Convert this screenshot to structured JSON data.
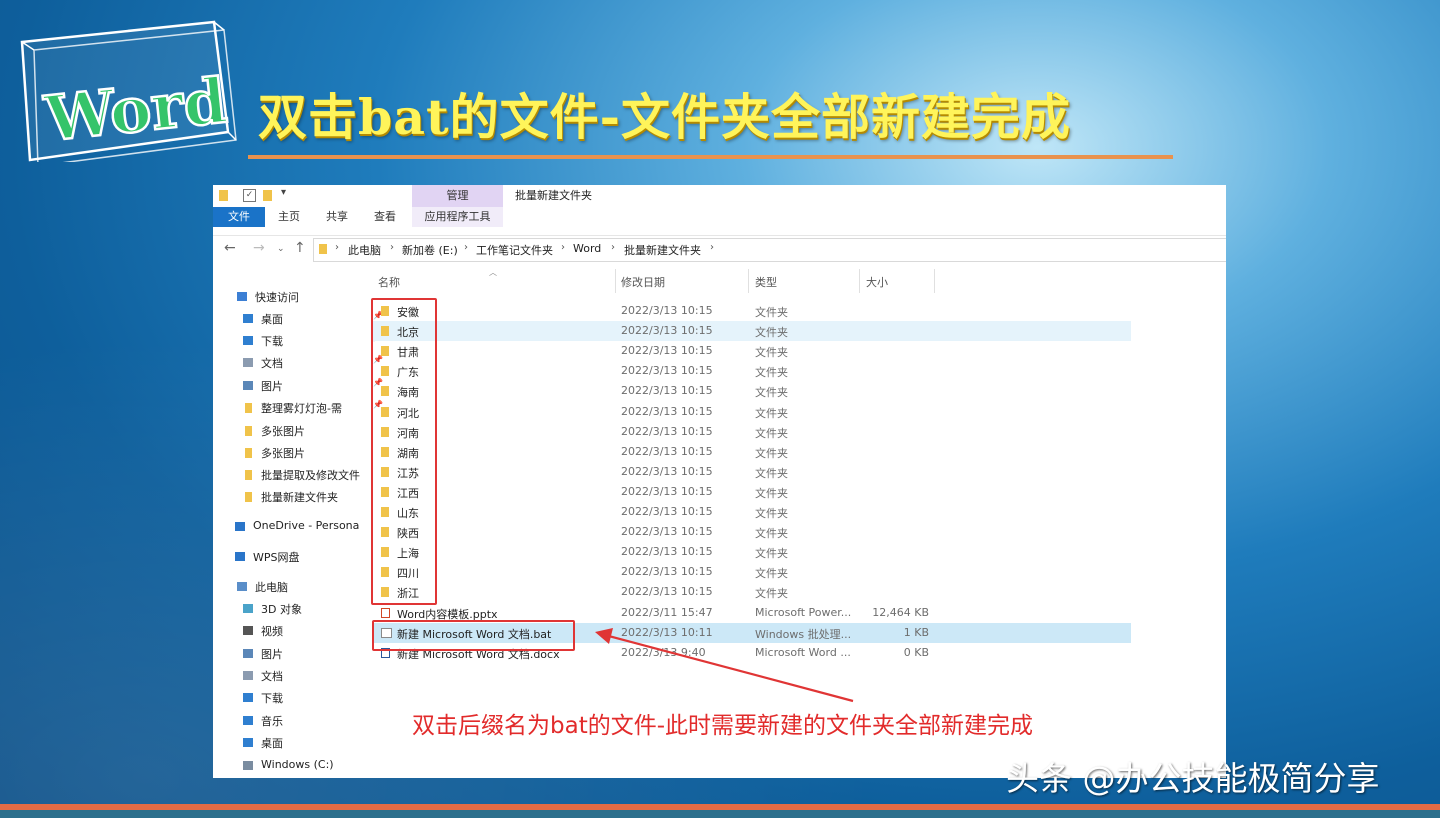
{
  "slide": {
    "logo_text": "Word",
    "title": "双击bat的文件-文件夹全部新建完成",
    "watermark": "头条 @办公技能极简分享"
  },
  "window": {
    "context_tab": "管理",
    "title": "批量新建文件夹",
    "ribbon_tabs": [
      "文件",
      "主页",
      "共享",
      "查看",
      "应用程序工具"
    ],
    "breadcrumb": [
      "此电脑",
      "新加卷 (E:)",
      "工作笔记文件夹",
      "Word",
      "批量新建文件夹"
    ]
  },
  "sidebar": {
    "items": [
      {
        "label": "快速访问",
        "icon": "star-icon"
      },
      {
        "label": "桌面",
        "icon": "desktop-icon",
        "pinned": true
      },
      {
        "label": "下载",
        "icon": "download-icon",
        "pinned": true
      },
      {
        "label": "文档",
        "icon": "document-icon",
        "pinned": true
      },
      {
        "label": "图片",
        "icon": "picture-icon",
        "pinned": true
      },
      {
        "label": "整理雾灯灯泡-需",
        "icon": "folder-icon",
        "pinned": true
      },
      {
        "label": "多张图片",
        "icon": "folder-icon"
      },
      {
        "label": "多张图片",
        "icon": "folder-icon"
      },
      {
        "label": "批量提取及修改文件",
        "icon": "folder-icon"
      },
      {
        "label": "批量新建文件夹",
        "icon": "folder-icon"
      },
      {
        "label": "OneDrive - Persona",
        "icon": "cloud-icon"
      },
      {
        "label": "WPS网盘",
        "icon": "cloud-icon"
      },
      {
        "label": "此电脑",
        "icon": "computer-icon"
      },
      {
        "label": "3D 对象",
        "icon": "cube-icon"
      },
      {
        "label": "视频",
        "icon": "video-icon"
      },
      {
        "label": "图片",
        "icon": "picture-icon"
      },
      {
        "label": "文档",
        "icon": "document-icon"
      },
      {
        "label": "下载",
        "icon": "download-icon"
      },
      {
        "label": "音乐",
        "icon": "music-icon"
      },
      {
        "label": "桌面",
        "icon": "desktop-icon"
      },
      {
        "label": "Windows (C:)",
        "icon": "drive-icon"
      }
    ]
  },
  "columns": {
    "name": "名称",
    "date": "修改日期",
    "type": "类型",
    "size": "大小"
  },
  "files": [
    {
      "name": "安徽",
      "date": "2022/3/13 10:15",
      "type": "文件夹",
      "size": "",
      "kind": "folder"
    },
    {
      "name": "北京",
      "date": "2022/3/13 10:15",
      "type": "文件夹",
      "size": "",
      "kind": "folder"
    },
    {
      "name": "甘肃",
      "date": "2022/3/13 10:15",
      "type": "文件夹",
      "size": "",
      "kind": "folder"
    },
    {
      "name": "广东",
      "date": "2022/3/13 10:15",
      "type": "文件夹",
      "size": "",
      "kind": "folder"
    },
    {
      "name": "海南",
      "date": "2022/3/13 10:15",
      "type": "文件夹",
      "size": "",
      "kind": "folder"
    },
    {
      "name": "河北",
      "date": "2022/3/13 10:15",
      "type": "文件夹",
      "size": "",
      "kind": "folder"
    },
    {
      "name": "河南",
      "date": "2022/3/13 10:15",
      "type": "文件夹",
      "size": "",
      "kind": "folder"
    },
    {
      "name": "湖南",
      "date": "2022/3/13 10:15",
      "type": "文件夹",
      "size": "",
      "kind": "folder"
    },
    {
      "name": "江苏",
      "date": "2022/3/13 10:15",
      "type": "文件夹",
      "size": "",
      "kind": "folder"
    },
    {
      "name": "江西",
      "date": "2022/3/13 10:15",
      "type": "文件夹",
      "size": "",
      "kind": "folder"
    },
    {
      "name": "山东",
      "date": "2022/3/13 10:15",
      "type": "文件夹",
      "size": "",
      "kind": "folder"
    },
    {
      "name": "陕西",
      "date": "2022/3/13 10:15",
      "type": "文件夹",
      "size": "",
      "kind": "folder"
    },
    {
      "name": "上海",
      "date": "2022/3/13 10:15",
      "type": "文件夹",
      "size": "",
      "kind": "folder"
    },
    {
      "name": "四川",
      "date": "2022/3/13 10:15",
      "type": "文件夹",
      "size": "",
      "kind": "folder"
    },
    {
      "name": "浙江",
      "date": "2022/3/13 10:15",
      "type": "文件夹",
      "size": "",
      "kind": "folder"
    },
    {
      "name": "Word内容模板.pptx",
      "date": "2022/3/11 15:47",
      "type": "Microsoft Power...",
      "size": "12,464 KB",
      "kind": "pptx"
    },
    {
      "name": "新建 Microsoft Word 文档.bat",
      "date": "2022/3/13 10:11",
      "type": "Windows 批处理...",
      "size": "1 KB",
      "kind": "bat"
    },
    {
      "name": "新建 Microsoft Word 文档.docx",
      "date": "2022/3/13 9:40",
      "type": "Microsoft Word ...",
      "size": "0 KB",
      "kind": "docx"
    }
  ],
  "annotation": "双击后缀名为bat的文件-此时需要新建的文件夹全部新建完成",
  "colors": {
    "accent": "#e03535",
    "title": "#fff45a",
    "ribbon_active": "#1a73c8"
  }
}
